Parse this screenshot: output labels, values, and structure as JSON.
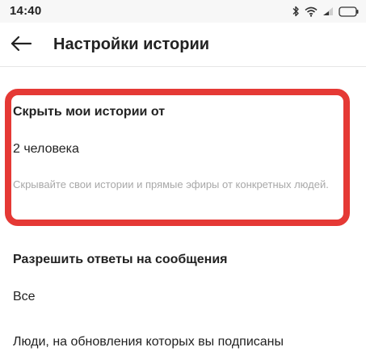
{
  "status_bar": {
    "time": "14:40",
    "icons": [
      "bluetooth-icon",
      "wifi-icon",
      "signal-icon",
      "battery-icon"
    ]
  },
  "header": {
    "back_icon": "arrow-left-icon",
    "title": "Настройки истории"
  },
  "hide_story": {
    "title": "Скрыть мои истории от",
    "value": "2 человека",
    "description": "Скрывайте свои истории и прямые эфиры от конкретных людей.",
    "highlight_color": "#e53935"
  },
  "replies": {
    "title": "Разрешить ответы на сообщения",
    "options": [
      {
        "label": "Все"
      },
      {
        "label": "Люди, на обновления которых вы подписаны"
      }
    ]
  }
}
